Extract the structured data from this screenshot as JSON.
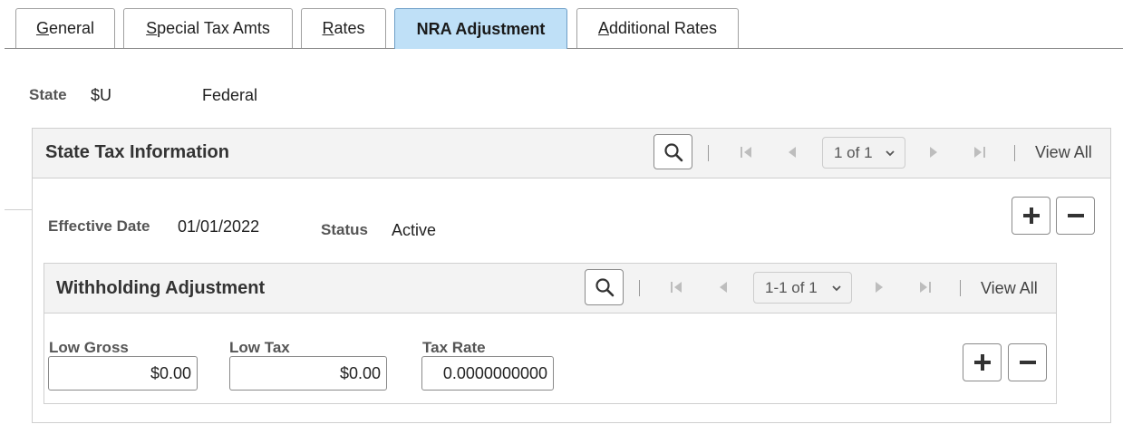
{
  "tabs": [
    {
      "label": "General",
      "underline": "G",
      "rest": "eneral"
    },
    {
      "label": "Special Tax Amts",
      "underline": "S",
      "rest": "pecial Tax Amts"
    },
    {
      "label": "Rates",
      "underline": "R",
      "rest": "ates"
    },
    {
      "label": "NRA Adjustment",
      "underline": "",
      "rest": "NRA Adjustment",
      "active": true
    },
    {
      "label": "Additional Rates",
      "underline": "A",
      "rest": "dditional Rates"
    }
  ],
  "header": {
    "state_label": "State",
    "state_value": "$U",
    "state_desc": "Federal"
  },
  "state_tax": {
    "title": "State Tax Information",
    "pager": "1 of 1",
    "view_all": "View All",
    "effective_date_label": "Effective Date",
    "effective_date": "01/01/2022",
    "status_label": "Status",
    "status": "Active"
  },
  "withholding": {
    "title": "Withholding Adjustment",
    "pager": "1-1 of 1",
    "view_all": "View All",
    "columns": {
      "low_gross": "Low Gross",
      "low_tax": "Low Tax",
      "tax_rate": "Tax Rate"
    },
    "row": {
      "low_gross": "$0.00",
      "low_tax": "$0.00",
      "tax_rate": "0.0000000000"
    }
  },
  "icons": {
    "search": "search-icon",
    "first": "first-page-icon",
    "prev": "previous-icon",
    "next": "next-icon",
    "last": "last-page-icon",
    "add": "plus-icon",
    "remove": "minus-icon",
    "dropdown": "chevron-down-icon"
  },
  "colors": {
    "active_tab": "#bfe0f7",
    "header_bg": "#f3f3f3"
  }
}
